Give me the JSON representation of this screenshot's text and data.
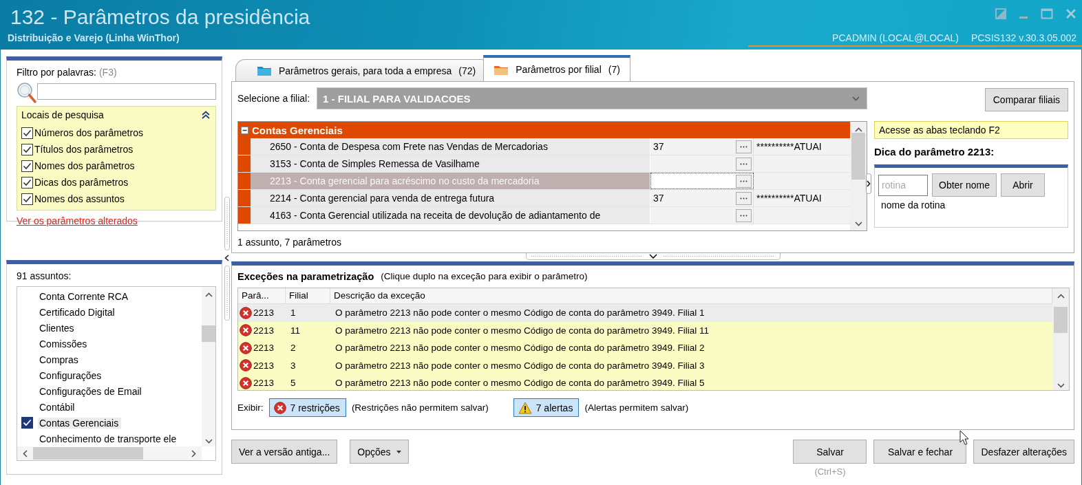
{
  "window": {
    "title": "132 - Parâmetros da presidência",
    "subtitle": "Distribuição e Varejo (Linha WinThor)",
    "user": "PCADMIN (LOCAL@LOCAL)",
    "version": "PCSIS132  v.30.3.05.002"
  },
  "filter": {
    "label": "Filtro por palavras:",
    "shortcut": "(F3)",
    "search_locations": {
      "title": "Locais de pesquisa",
      "expanded": true,
      "options": [
        {
          "label": "Números dos parâmetros",
          "checked": true
        },
        {
          "label": "Títulos dos parâmetros",
          "checked": true
        },
        {
          "label": "Nomes dos parâmetros",
          "checked": true
        },
        {
          "label": "Dicas dos parâmetros",
          "checked": true
        },
        {
          "label": "Nomes dos assuntos",
          "checked": true
        }
      ]
    },
    "link": "Ver os parâmetros alterados"
  },
  "subjects": {
    "count": "91 assuntos:",
    "items": [
      {
        "label": "Conta Corrente RCA",
        "checked": false
      },
      {
        "label": "Certificado Digital",
        "checked": false
      },
      {
        "label": "Clientes",
        "checked": false
      },
      {
        "label": "Comissões",
        "checked": false
      },
      {
        "label": "Compras",
        "checked": false
      },
      {
        "label": "Configurações",
        "checked": false
      },
      {
        "label": "Configurações de Email",
        "checked": false
      },
      {
        "label": "Contábil",
        "checked": false
      },
      {
        "label": "Contas Gerenciais",
        "checked": true
      },
      {
        "label": "Conhecimento de transporte ele",
        "checked": false
      }
    ]
  },
  "tabs": [
    {
      "label": "Parâmetros gerais, para toda a empresa",
      "count": "(72)",
      "selected": false
    },
    {
      "label": "Parâmetros por filial",
      "count": "(7)",
      "selected": true
    }
  ],
  "branch": {
    "label": "Selecione a filial:",
    "value": "1 - FILIAL PARA VALIDACOES"
  },
  "compare_button": "Comparar filiais",
  "grid": {
    "group": "Contas Gerenciais",
    "expanded": true,
    "rows": [
      {
        "title": "2650 - Conta de Despesa com Frete nas Vendas de Mercadorias",
        "value": "37",
        "extra": "**********ATUAI",
        "selected": false
      },
      {
        "title": "3153 - Conta de Simples Remessa de Vasilhame",
        "selected": false
      },
      {
        "title": "2213 - Conta gerencial para acréscimo no custo da mercadoria",
        "selected": true
      },
      {
        "title": "2214 - Conta gerencial para venda de entrega futura",
        "value": "37",
        "extra": "**********ATUAI",
        "selected": false
      },
      {
        "title": "4163 - Conta Gerencial utilizada na receita de devolução de adiantamento de",
        "selected": false
      }
    ],
    "summary": "1 assunto, 7 parâmetros"
  },
  "hint": {
    "notice": "Acesse as abas teclando F2",
    "title": "Dica do parâmetro 2213:",
    "routine_placeholder": "rotina",
    "buttons": [
      "Obter nome",
      "Abrir"
    ],
    "routine_name": "nome da rotina"
  },
  "exceptions": {
    "title": "Exceções na parametrização",
    "note": "(Clique duplo na exceção para exibir o parâmetro)",
    "columns": [
      "Parâ...",
      "Filial",
      "Descrição da exceção"
    ],
    "rows": [
      {
        "param": "2213",
        "branch": "1",
        "description": "O parâmetro 2213 não pode conter o mesmo Código de conta do parâmetro 3949. Filial 1",
        "selected": true
      },
      {
        "param": "2213",
        "branch": "11",
        "description": "O parâmetro 2213 não pode conter o mesmo Código de conta do parâmetro 3949. Filial 11",
        "selected": false
      },
      {
        "param": "2213",
        "branch": "2",
        "description": "O parâmetro 2213 não pode conter o mesmo Código de conta do parâmetro 3949. Filial 2",
        "selected": false
      },
      {
        "param": "2213",
        "branch": "3",
        "description": "O parâmetro 2213 não pode conter o mesmo Código de conta do parâmetro 3949. Filial 3",
        "selected": false
      },
      {
        "param": "2213",
        "branch": "5",
        "description": "O parâmetro 2213 não pode conter o mesmo Código de conta do parâmetro 3949. Filial 5",
        "selected": false
      }
    ],
    "show_label": "Exibir:",
    "filters": [
      {
        "kind": "error",
        "label": "7 restrições",
        "note": "(Restrições não permitem salvar)",
        "on": true
      },
      {
        "kind": "warning",
        "label": "7 alertas",
        "note": "(Alertas permitem salvar)",
        "on": true
      }
    ]
  },
  "actions": {
    "left": [
      {
        "label": "Ver a versão antiga...",
        "dropdown": false
      },
      {
        "label": "Opções",
        "dropdown": true
      }
    ],
    "right": [
      {
        "label": "Salvar",
        "shortcut": "(Ctrl+S)"
      },
      {
        "label": "Salvar e fechar"
      },
      {
        "label": "Desfazer alterações"
      }
    ]
  }
}
